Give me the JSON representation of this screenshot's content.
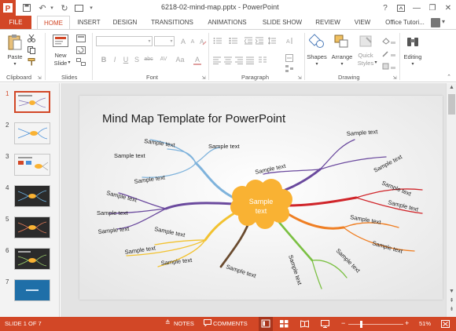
{
  "window": {
    "title": "6218-02-mind-map.pptx - PowerPoint",
    "help": "?",
    "minimize": "—",
    "restore": "❐",
    "close": "✕"
  },
  "tabs": {
    "file": "FILE",
    "home": "HOME",
    "insert": "INSERT",
    "design": "DESIGN",
    "transitions": "TRANSITIONS",
    "animations": "ANIMATIONS",
    "slideshow": "SLIDE SHOW",
    "review": "REVIEW",
    "view": "VIEW",
    "account": "Office Tutori..."
  },
  "ribbon": {
    "paste": "Paste",
    "new_slide_line1": "New",
    "new_slide_line2": "Slide",
    "shapes": "Shapes",
    "arrange": "Arrange",
    "quick_styles_line1": "Quick",
    "quick_styles_line2": "Styles",
    "editing": "Editing",
    "groups": {
      "clipboard": "Clipboard",
      "slides": "Slides",
      "font": "Font",
      "paragraph": "Paragraph",
      "drawing": "Drawing"
    },
    "format_buttons": [
      "B",
      "I",
      "U",
      "S",
      "abc",
      "AV",
      "Aa",
      "A"
    ]
  },
  "thumbnails": [
    "1",
    "2",
    "3",
    "4",
    "5",
    "6",
    "7"
  ],
  "slide": {
    "title": "Mind Map Template for PowerPoint",
    "center_line1": "Sample",
    "center_line2": "text",
    "branch_label": "Sample text"
  },
  "status": {
    "slide_info": "SLIDE 1 OF 7",
    "notes": "NOTES",
    "comments": "COMMENTS",
    "zoom": "51%"
  },
  "colors": {
    "accent": "#d24726",
    "cloud": "#f9b233"
  }
}
